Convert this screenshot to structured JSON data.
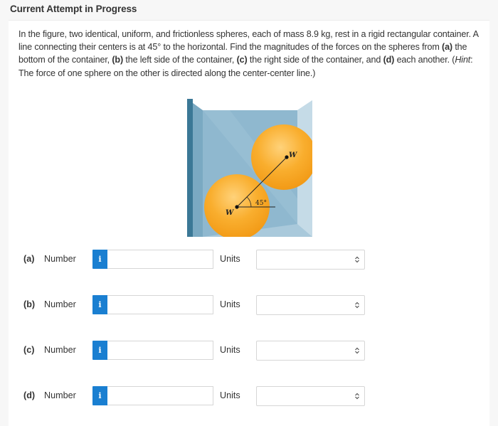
{
  "header": {
    "title": "Current Attempt in Progress"
  },
  "question": {
    "text_1": "In the figure, two identical, uniform, and frictionless spheres, each of mass 8.9 kg, rest in a rigid rectangular container. A line connecting their centers is at 45° to the horizontal. Find the magnitudes of the forces on the spheres from ",
    "a_label": "(a)",
    "a_text": " the bottom of the container, ",
    "b_label": "(b)",
    "b_text": " the left side of the container, ",
    "c_label": "(c)",
    "c_text": " the right side of the container, and ",
    "d_label": "(d)",
    "d_text": " each another. (",
    "hint_label": "Hint",
    "hint_text": ": The force of one sphere on the other is directed along the center-center line.)"
  },
  "figure": {
    "upper_sphere_label": "W",
    "lower_sphere_label": "W",
    "angle_label": "45°",
    "colors": {
      "sphere": "#f6a623",
      "container": "#8fb8cf",
      "wall": "#3b7896"
    }
  },
  "answers": [
    {
      "part": "(a)",
      "number_label": "Number",
      "info_icon": "i",
      "number_value": "",
      "units_label": "Units",
      "units_value": ""
    },
    {
      "part": "(b)",
      "number_label": "Number",
      "info_icon": "i",
      "number_value": "",
      "units_label": "Units",
      "units_value": ""
    },
    {
      "part": "(c)",
      "number_label": "Number",
      "info_icon": "i",
      "number_value": "",
      "units_label": "Units",
      "units_value": ""
    },
    {
      "part": "(d)",
      "number_label": "Number",
      "info_icon": "i",
      "number_value": "",
      "units_label": "Units",
      "units_value": ""
    }
  ],
  "colors": {
    "accent": "#1a7fd1",
    "page_background": "#f7f7f7",
    "panel_background": "#ffffff"
  }
}
